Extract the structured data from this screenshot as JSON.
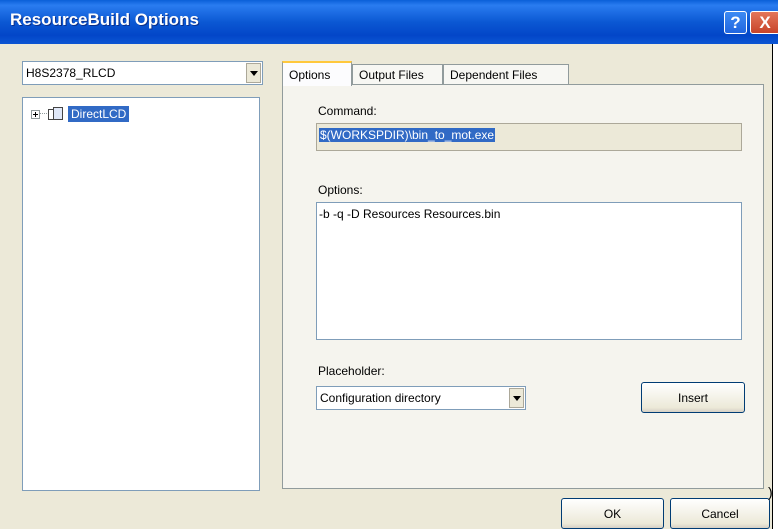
{
  "window": {
    "title": "ResourceBuild Options"
  },
  "titlebar": {
    "help_glyph": "?",
    "close_glyph": "X"
  },
  "config_combo": {
    "selected": "H8S2378_RLCD"
  },
  "tree": {
    "items": [
      {
        "label": "DirectLCD",
        "icon": "project-icon",
        "selected": true
      }
    ]
  },
  "tabs": [
    {
      "label": "Options",
      "active": true
    },
    {
      "label": "Output Files",
      "active": false
    },
    {
      "label": "Dependent Files",
      "active": false
    }
  ],
  "options_tab": {
    "command_label": "Command:",
    "command_value": "$(WORKSPDIR)\\bin_to_mot.exe",
    "options_label": "Options:",
    "options_value": "-b -q -D Resources Resources.bin",
    "placeholder_label": "Placeholder:",
    "placeholder_selected": "Configuration directory",
    "insert_label": "Insert"
  },
  "footer": {
    "ok_label": "OK",
    "cancel_label": "Cancel",
    "stray_glyph": ")"
  },
  "colors": {
    "titlebar": "#0b58d3",
    "selection": "#316ac5",
    "dialog_bg": "#ece9d8",
    "close_button": "#c8442a"
  }
}
